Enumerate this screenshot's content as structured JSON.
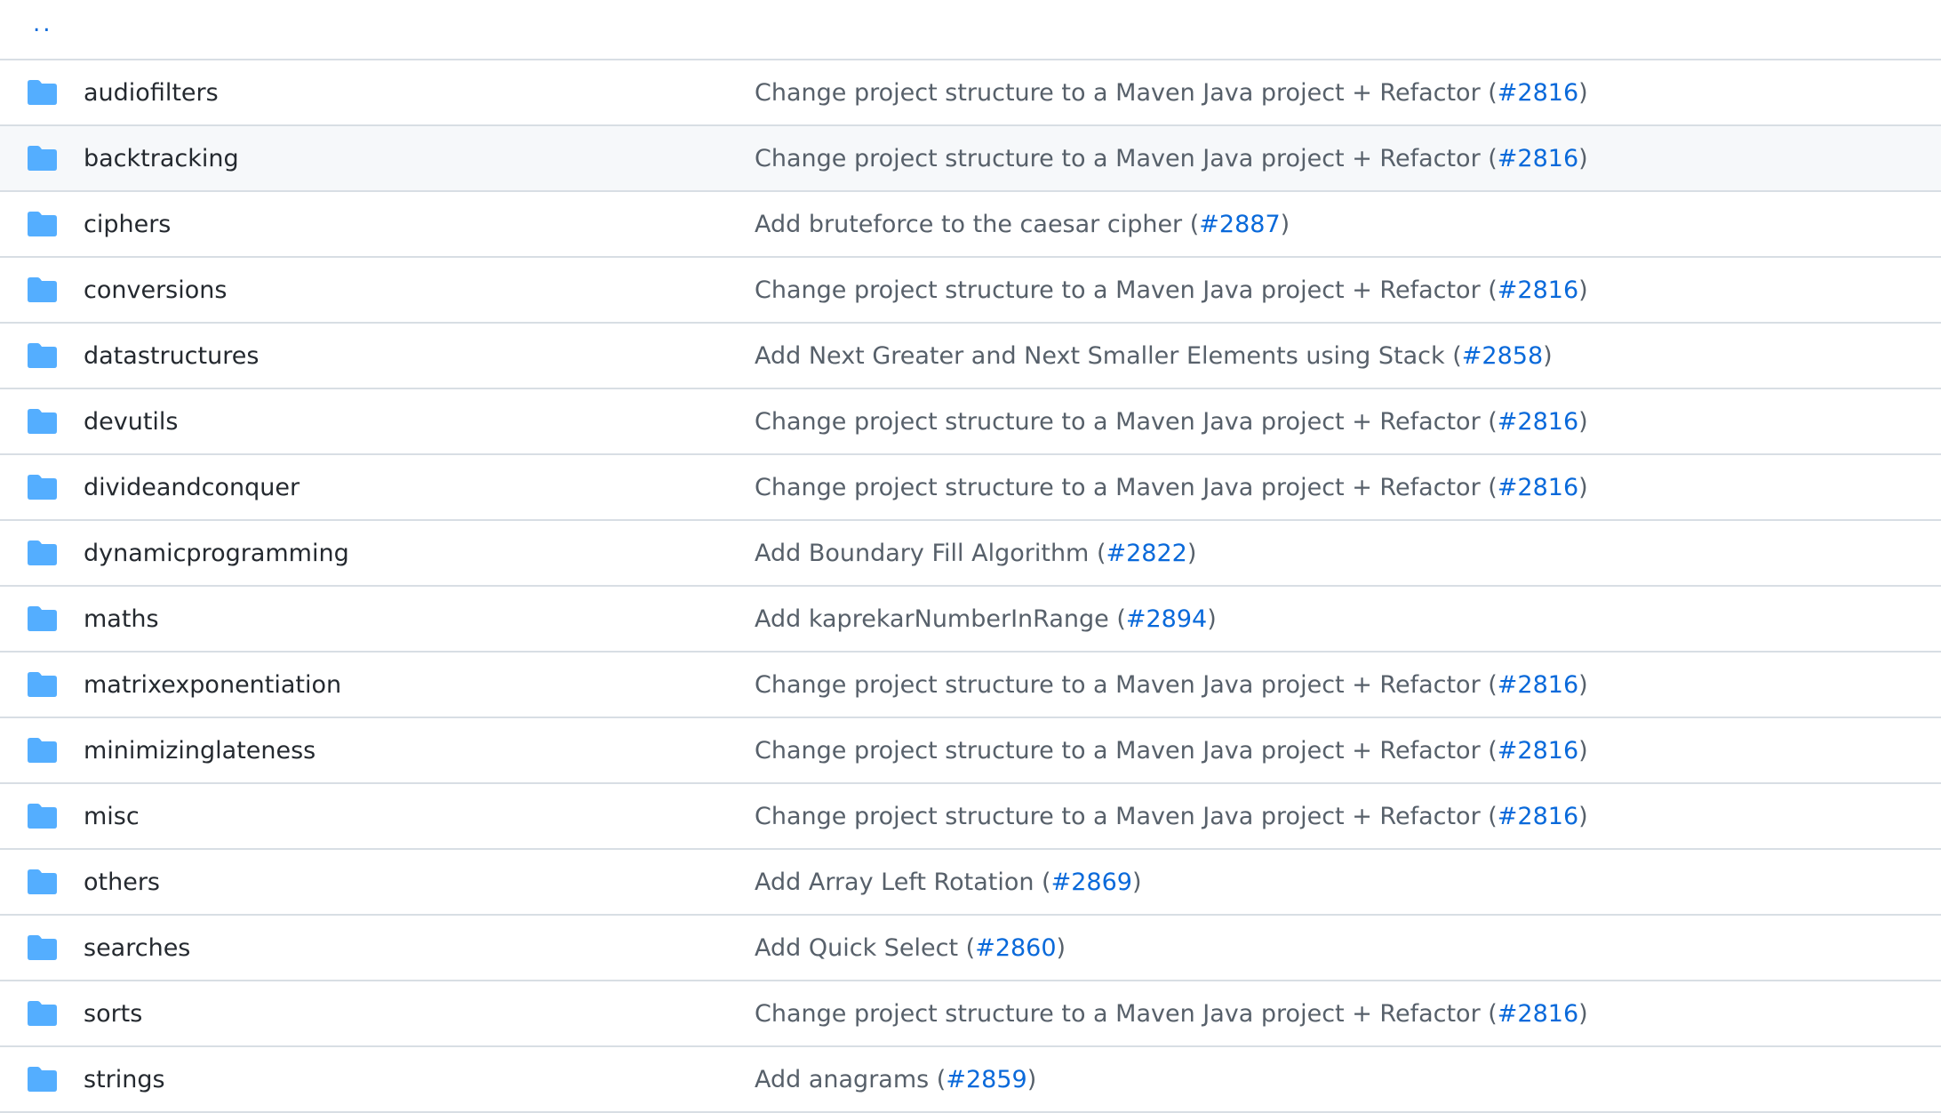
{
  "parent_link": "..",
  "colors": {
    "folder": "#54aeff",
    "link": "#0969da",
    "text": "#24292f",
    "muted": "#57606a",
    "border": "#d8dee4",
    "hover_row": "#f6f8fa"
  },
  "rows": [
    {
      "name": "audiofilters",
      "commit": "Change project structure to a Maven Java project + Refactor",
      "pr": "#2816",
      "icon": "folder-icon"
    },
    {
      "name": "backtracking",
      "commit": "Change project structure to a Maven Java project + Refactor",
      "pr": "#2816",
      "icon": "folder-icon",
      "highlighted": true
    },
    {
      "name": "ciphers",
      "commit": "Add bruteforce to the caesar cipher",
      "pr": "#2887",
      "icon": "folder-icon"
    },
    {
      "name": "conversions",
      "commit": "Change project structure to a Maven Java project + Refactor",
      "pr": "#2816",
      "icon": "folder-icon"
    },
    {
      "name": "datastructures",
      "commit": "Add Next Greater and Next Smaller Elements using Stack",
      "pr": "#2858",
      "icon": "folder-icon"
    },
    {
      "name": "devutils",
      "commit": "Change project structure to a Maven Java project + Refactor",
      "pr": "#2816",
      "icon": "folder-icon"
    },
    {
      "name": "divideandconquer",
      "commit": "Change project structure to a Maven Java project + Refactor",
      "pr": "#2816",
      "icon": "folder-icon"
    },
    {
      "name": "dynamicprogramming",
      "commit": "Add Boundary Fill Algorithm",
      "pr": "#2822",
      "icon": "folder-icon"
    },
    {
      "name": "maths",
      "commit": "Add kaprekarNumberInRange",
      "pr": "#2894",
      "icon": "folder-icon"
    },
    {
      "name": "matrixexponentiation",
      "commit": "Change project structure to a Maven Java project + Refactor",
      "pr": "#2816",
      "icon": "folder-icon"
    },
    {
      "name": "minimizinglateness",
      "commit": "Change project structure to a Maven Java project + Refactor",
      "pr": "#2816",
      "icon": "folder-icon"
    },
    {
      "name": "misc",
      "commit": "Change project structure to a Maven Java project + Refactor",
      "pr": "#2816",
      "icon": "folder-icon"
    },
    {
      "name": "others",
      "commit": "Add Array Left Rotation",
      "pr": "#2869",
      "icon": "folder-icon"
    },
    {
      "name": "searches",
      "commit": "Add Quick Select",
      "pr": "#2860",
      "icon": "folder-icon"
    },
    {
      "name": "sorts",
      "commit": "Change project structure to a Maven Java project + Refactor",
      "pr": "#2816",
      "icon": "folder-icon"
    },
    {
      "name": "strings",
      "commit": "Add anagrams",
      "pr": "#2859",
      "icon": "folder-icon"
    }
  ]
}
